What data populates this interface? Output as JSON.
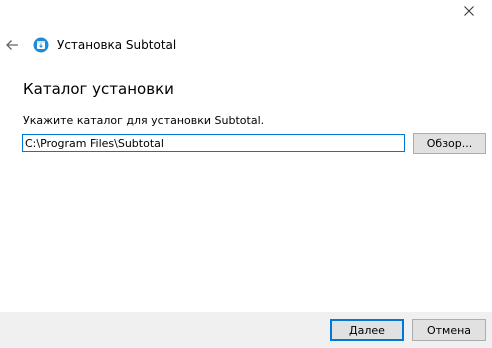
{
  "window": {
    "title": "Установка Subtotal",
    "close_icon": "close-icon",
    "back_icon": "back-arrow-icon",
    "app_icon": "installer-app-icon"
  },
  "page": {
    "heading": "Каталог установки",
    "instruction": "Укажите каталог для установки Subtotal.",
    "path_value": "C:\\Program Files\\Subtotal",
    "browse_label": "Обзор..."
  },
  "footer": {
    "next_label": "Далее",
    "cancel_label": "Отмена"
  },
  "colors": {
    "accent": "#0078d7",
    "button_face": "#e1e1e1",
    "footer_bg": "#f0f0f0"
  }
}
